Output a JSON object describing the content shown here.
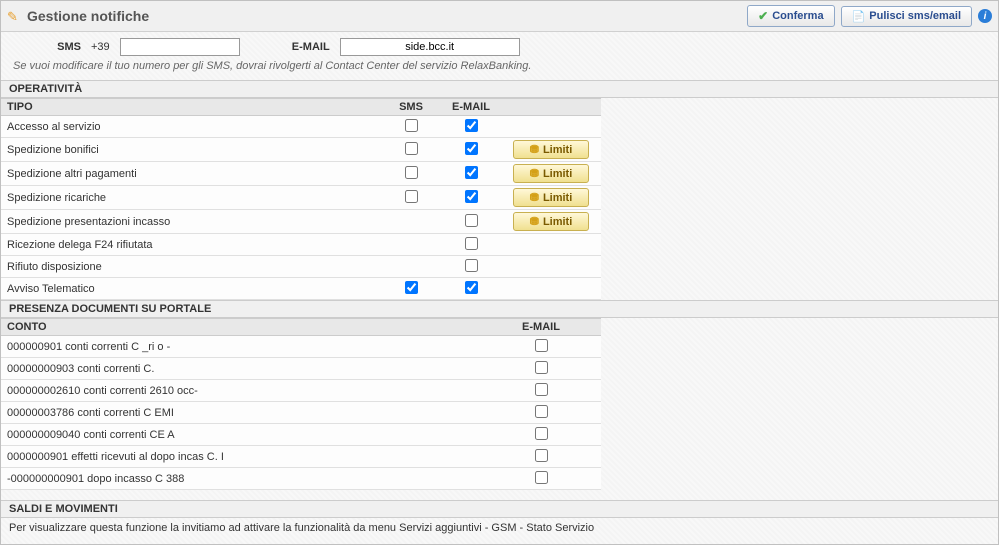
{
  "header": {
    "title": "Gestione notifiche",
    "confirm_label": "Conferma",
    "clear_label": "Pulisci sms/email"
  },
  "contact": {
    "sms_label": "SMS",
    "sms_prefix": "+39",
    "sms_value": "",
    "email_label": "E-MAIL",
    "email_value": "side.bcc.it",
    "helper": "Se vuoi modificare il tuo numero per gli SMS, dovrai rivolgerti al Contact Center del servizio RelaxBanking."
  },
  "operativita": {
    "section_label": "OPERATIVITÀ",
    "col_tipo": "TIPO",
    "col_sms": "SMS",
    "col_email": "E-MAIL",
    "limiti_label": "Limiti",
    "rows": [
      {
        "tipo": "Accesso al servizio",
        "sms": false,
        "email": true,
        "limiti": false
      },
      {
        "tipo": "Spedizione bonifici",
        "sms": false,
        "email": true,
        "limiti": true
      },
      {
        "tipo": "Spedizione altri pagamenti",
        "sms": false,
        "email": true,
        "limiti": true
      },
      {
        "tipo": "Spedizione ricariche",
        "sms": false,
        "email": true,
        "limiti": true
      },
      {
        "tipo": "Spedizione presentazioni incasso",
        "sms": null,
        "email": false,
        "limiti": true
      },
      {
        "tipo": "Ricezione delega F24 rifiutata",
        "sms": null,
        "email": false,
        "limiti": false
      },
      {
        "tipo": "Rifiuto disposizione",
        "sms": null,
        "email": false,
        "limiti": false
      },
      {
        "tipo": "Avviso Telematico",
        "sms": true,
        "email": true,
        "limiti": false
      }
    ]
  },
  "presenza": {
    "section_label": "PRESENZA DOCUMENTI SU PORTALE",
    "col_conto": "CONTO",
    "col_email": "E-MAIL",
    "rows": [
      {
        "conto": "000000901 conti correnti C                  _ri        o -",
        "email": false
      },
      {
        "conto": "00000000903 conti correnti C.                ",
        "email": false
      },
      {
        "conto": "000000002610 conti correnti 2610                              occ-",
        "email": false
      },
      {
        "conto": "00000003786 conti correnti C                  EMI",
        "email": false
      },
      {
        "conto": "000000009040 conti correnti CE                     A",
        "email": false
      },
      {
        "conto": "0000000901 effetti ricevuti al dopo incas C.                   I",
        "email": false
      },
      {
        "conto": "-000000000901 dopo incasso C                     388",
        "email": false
      }
    ]
  },
  "saldi": {
    "section_label": "SALDI E MOVIMENTI",
    "note": "Per visualizzare questa funzione la invitiamo ad attivare la funzionalità da menu Servizi aggiuntivi - GSM - Stato Servizio"
  }
}
